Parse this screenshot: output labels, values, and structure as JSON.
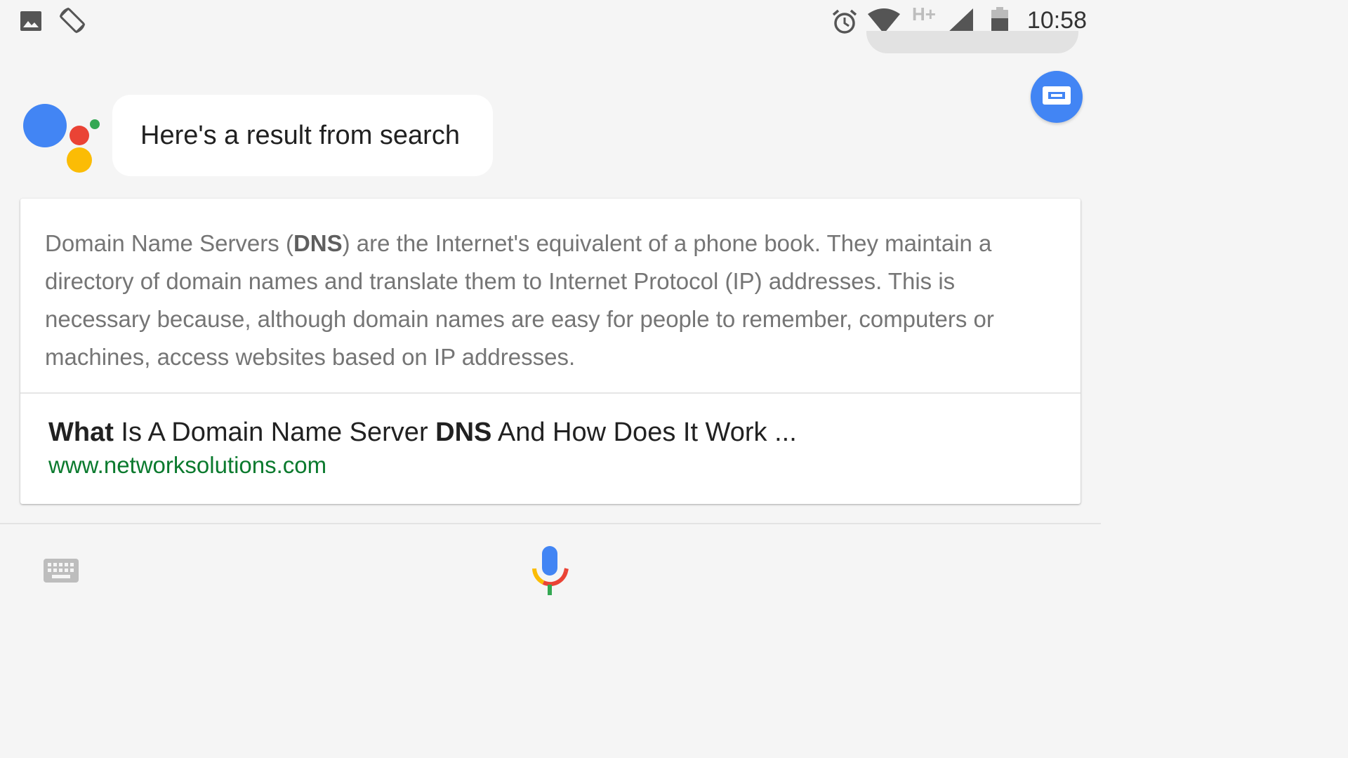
{
  "status_bar": {
    "time": "10:58",
    "network_type": "H+",
    "icons": [
      "image-icon",
      "screen-rotation-icon",
      "alarm-icon",
      "wifi-icon",
      "network-type-icon",
      "cellular-signal-icon",
      "battery-icon"
    ]
  },
  "assistant": {
    "message": "Here's a result from search",
    "logo_colors": {
      "blue": "#4285f4",
      "red": "#ea4335",
      "yellow": "#fbbc05",
      "green": "#34a853"
    }
  },
  "result_card": {
    "snippet": {
      "before_bold": "Domain Name Servers (",
      "bold": "DNS",
      "after_bold": ") are the Internet's equivalent of a phone book. They maintain a directory of domain names and translate them to Internet Protocol (IP) addresses. This is necessary because, although domain names are easy for people to remember, computers or machines, access websites based on IP addresses."
    },
    "title": {
      "part1_bold": "What",
      "part2": " Is A Domain Name Server ",
      "part3_bold": "DNS",
      "part4": " And How Does It Work ..."
    },
    "url": "www.networksolutions.com",
    "url_color": "#0b7a2e"
  },
  "bottom_bar": {
    "keyboard_icon": "keyboard-icon",
    "mic_icon": "mic-icon"
  },
  "colors": {
    "background": "#f5f5f5",
    "accent": "#4285f4"
  }
}
